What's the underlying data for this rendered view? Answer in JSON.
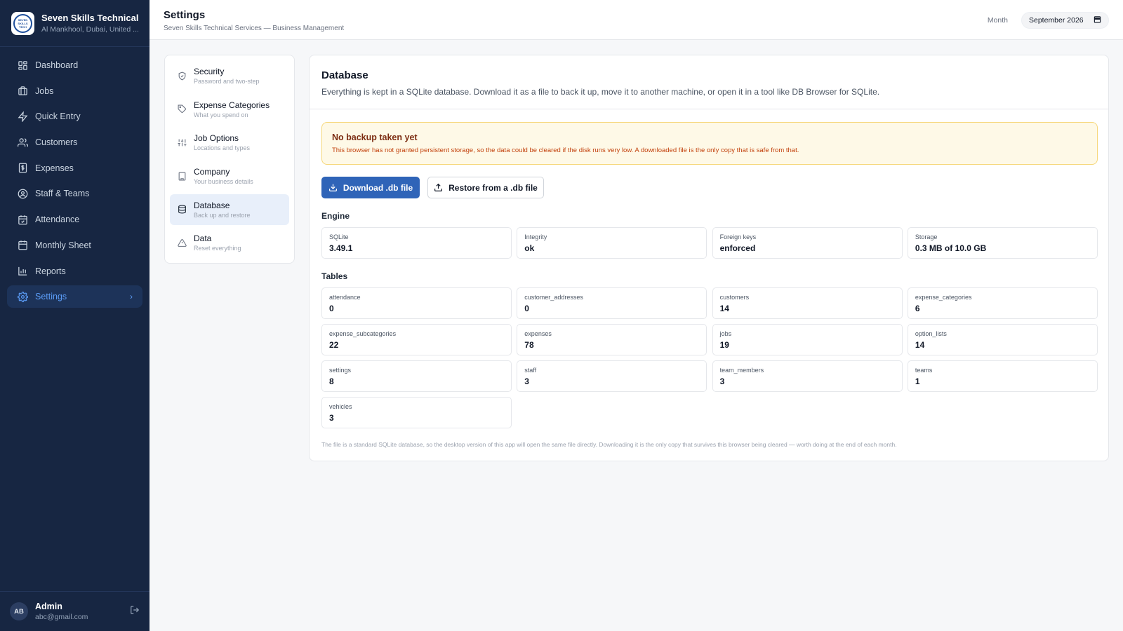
{
  "brand": {
    "name": "Seven Skills Technical ...",
    "location": "Al Mankhool, Dubai, United ...",
    "logo_text": "SEVEN SKILLS TECHNICAL"
  },
  "nav": {
    "items": [
      {
        "label": "Dashboard",
        "icon": "dashboard-icon"
      },
      {
        "label": "Jobs",
        "icon": "briefcase-icon"
      },
      {
        "label": "Quick Entry",
        "icon": "lightning-icon"
      },
      {
        "label": "Customers",
        "icon": "users-icon"
      },
      {
        "label": "Expenses",
        "icon": "receipt-icon"
      },
      {
        "label": "Staff & Teams",
        "icon": "staff-icon"
      },
      {
        "label": "Attendance",
        "icon": "calendar-check-icon"
      },
      {
        "label": "Monthly Sheet",
        "icon": "calendar-icon"
      },
      {
        "label": "Reports",
        "icon": "bar-chart-icon"
      },
      {
        "label": "Settings",
        "icon": "gear-icon",
        "active": true
      }
    ]
  },
  "user": {
    "initials": "AB",
    "name": "Admin",
    "email": "abc@gmail.com"
  },
  "header": {
    "title": "Settings",
    "subtitle": "Seven Skills Technical Services — Business Management",
    "month_label": "Month",
    "month_value": "September 2026"
  },
  "settings_menu": {
    "items": [
      {
        "title": "Security",
        "desc": "Password and two-step",
        "icon": "shield-icon"
      },
      {
        "title": "Expense Categories",
        "desc": "What you spend on",
        "icon": "tags-icon"
      },
      {
        "title": "Job Options",
        "desc": "Locations and types",
        "icon": "sliders-icon"
      },
      {
        "title": "Company",
        "desc": "Your business details",
        "icon": "building-icon"
      },
      {
        "title": "Database",
        "desc": "Back up and restore",
        "icon": "database-icon",
        "active": true
      },
      {
        "title": "Data",
        "desc": "Reset everything",
        "icon": "warning-icon"
      }
    ]
  },
  "database": {
    "title": "Database",
    "description": "Everything is kept in a SQLite database. Download it as a file to back it up, move it to another machine, or open it in a tool like DB Browser for SQLite.",
    "alert_title": "No backup taken yet",
    "alert_text": "This browser has not granted persistent storage, so the data could be cleared if the disk runs very low. A downloaded file is the only copy that is safe from that.",
    "download_label": "Download .db file",
    "restore_label": "Restore from a .db file",
    "engine_label": "Engine",
    "engine": [
      {
        "label": "SQLite",
        "value": "3.49.1"
      },
      {
        "label": "Integrity",
        "value": "ok"
      },
      {
        "label": "Foreign keys",
        "value": "enforced"
      },
      {
        "label": "Storage",
        "value": "0.3 MB of 10.0 GB"
      }
    ],
    "tables_label": "Tables",
    "tables": [
      {
        "label": "attendance",
        "value": "0"
      },
      {
        "label": "customer_addresses",
        "value": "0"
      },
      {
        "label": "customers",
        "value": "14"
      },
      {
        "label": "expense_categories",
        "value": "6"
      },
      {
        "label": "expense_subcategories",
        "value": "22"
      },
      {
        "label": "expenses",
        "value": "78"
      },
      {
        "label": "jobs",
        "value": "19"
      },
      {
        "label": "option_lists",
        "value": "14"
      },
      {
        "label": "settings",
        "value": "8"
      },
      {
        "label": "staff",
        "value": "3"
      },
      {
        "label": "team_members",
        "value": "3"
      },
      {
        "label": "teams",
        "value": "1"
      },
      {
        "label": "vehicles",
        "value": "3"
      }
    ],
    "footnote": "The file is a standard SQLite database, so the desktop version of this app will open the same file directly. Downloading it is the only copy that survives this browser being cleared — worth doing at the end of each month."
  }
}
